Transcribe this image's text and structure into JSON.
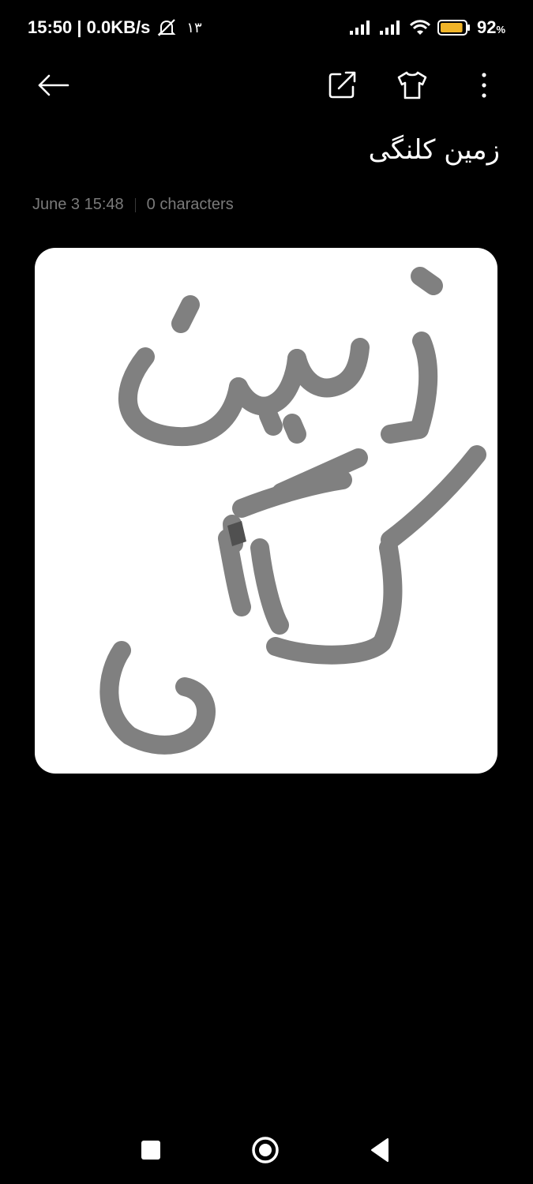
{
  "status": {
    "time_speed": "15:50 | 0.0KB/s",
    "notification_count": "١٣",
    "battery_percent": "92",
    "battery_unit": "%",
    "battery_color": "#f0b429"
  },
  "toolbar": {
    "back_icon": "arrow-left-icon",
    "share_icon": "external-share-icon",
    "theme_icon": "tshirt-icon",
    "more_icon": "more-vertical-icon"
  },
  "note": {
    "title": "زمین کلنگی",
    "date": "June 3 15:48",
    "characters": "0 characters"
  },
  "nav": {
    "recents_icon": "square-icon",
    "home_icon": "circle-icon",
    "back_icon": "triangle-back-icon"
  }
}
